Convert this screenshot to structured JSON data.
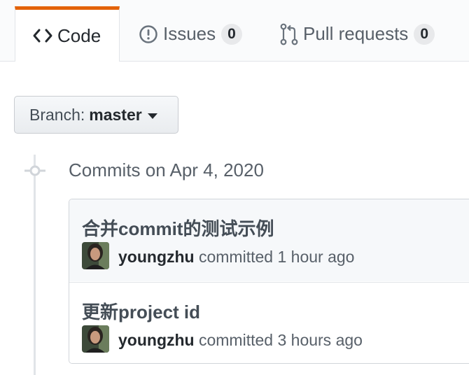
{
  "tabs": [
    {
      "label": "Code",
      "icon": "code-icon",
      "selected": true
    },
    {
      "label": "Issues",
      "icon": "issue-icon",
      "count": "0"
    },
    {
      "label": "Pull requests",
      "icon": "pull-request-icon",
      "count": "0"
    }
  ],
  "branch": {
    "prefix": "Branch:",
    "name": "master"
  },
  "commits_heading": "Commits on Apr 4, 2020",
  "commits": [
    {
      "title": "合并commit的测试示例",
      "author": "youngzhu",
      "action": "committed",
      "time": "1 hour ago"
    },
    {
      "title": "更新project id",
      "author": "youngzhu",
      "action": "committed",
      "time": "3 hours ago"
    }
  ],
  "colors": {
    "accent": "#e36209",
    "text": "#24292e",
    "muted": "#586069",
    "border": "#e1e4e8"
  }
}
